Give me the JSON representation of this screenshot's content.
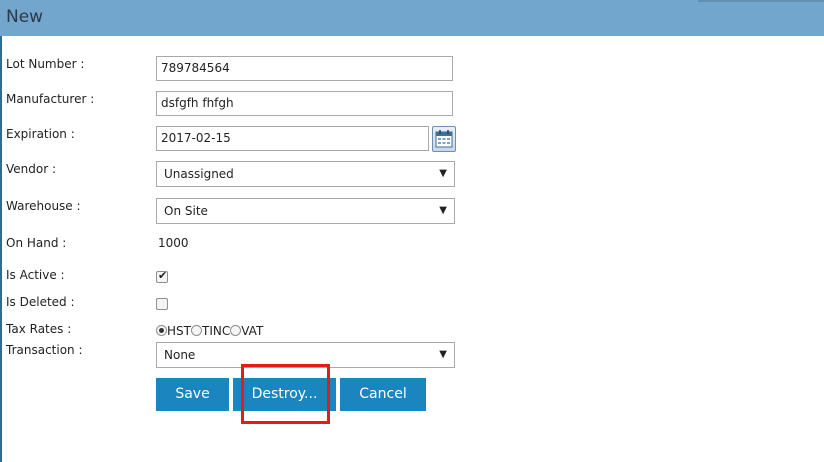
{
  "header": {
    "title": "New"
  },
  "form": {
    "lot_number": {
      "label": "Lot Number :",
      "value": "789784564"
    },
    "manufacturer": {
      "label": "Manufacturer :",
      "value": "dsfgfh fhfgh"
    },
    "expiration": {
      "label": "Expiration :",
      "value": "2017-02-15"
    },
    "vendor": {
      "label": "Vendor :",
      "value": "Unassigned"
    },
    "warehouse": {
      "label": "Warehouse :",
      "value": "On Site"
    },
    "on_hand": {
      "label": "On Hand :",
      "value": "1000"
    },
    "is_active": {
      "label": "Is Active :",
      "checked": true
    },
    "is_deleted": {
      "label": "Is Deleted :",
      "checked": false
    },
    "tax_rates": {
      "label": "Tax Rates :",
      "options": [
        "HST",
        "TINC",
        "VAT"
      ],
      "selected": "HST"
    },
    "transaction": {
      "label": "Transaction :",
      "value": "None"
    }
  },
  "buttons": {
    "save": "Save",
    "destroy": "Destroy...",
    "cancel": "Cancel"
  },
  "colors": {
    "header": "#72a6cc",
    "button": "#1b85c0",
    "highlight": "#e41b1b"
  }
}
